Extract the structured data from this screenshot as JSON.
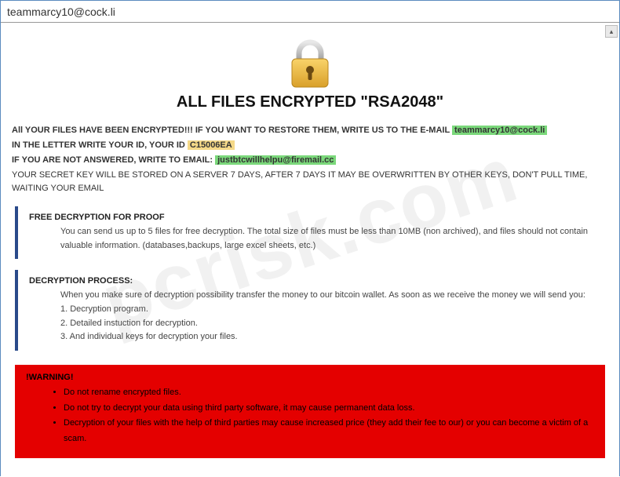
{
  "title": "teammarcy10@cock.li",
  "heading": "ALL FILES ENCRYPTED \"RSA2048\"",
  "intro": {
    "line1_pre": "All YOUR FILES HAVE BEEN ENCRYPTED!!! IF YOU WANT TO RESTORE THEM, WRITE US TO THE E-MAIL ",
    "email1": "teammarcy10@cock.li",
    "line2_pre": "IN THE LETTER WRITE YOUR ID, YOUR ID ",
    "id": "C15006EA",
    "line3_pre": "IF YOU ARE NOT ANSWERED, WRITE TO EMAIL: ",
    "email2": "justbtcwillhelpu@firemail.cc",
    "line4": "YOUR SECRET KEY WILL BE STORED ON A SERVER 7 DAYS, AFTER 7 DAYS IT MAY BE OVERWRITTEN BY OTHER KEYS, DON'T PULL TIME, WAITING YOUR EMAIL"
  },
  "proof": {
    "title": "FREE DECRYPTION FOR PROOF",
    "body": "You can send us up to 5 files for free decryption. The total size of files must be less than 10MB (non archived), and files should not contain valuable information. (databases,backups, large excel sheets, etc.)"
  },
  "process": {
    "title": "DECRYPTION PROCESS:",
    "intro": "When you make sure of decryption possibility transfer the money to our bitcoin wallet. As soon as we receive the money we will send you:",
    "step1": "1. Decryption program.",
    "step2": "2. Detailed instuction for decryption.",
    "step3": "3. And individual keys for decryption your files."
  },
  "warning": {
    "title": "!WARNING!",
    "b1": "Do not rename encrypted files.",
    "b2": "Do not try to decrypt your data using third party software, it may cause permanent data loss.",
    "b3": "Decryption of your files with the help of third parties may cause increased price (they add their fee to our) or you can become a victim of a scam."
  },
  "watermark": "pcrisk.com",
  "scroll_glyph": "▴"
}
